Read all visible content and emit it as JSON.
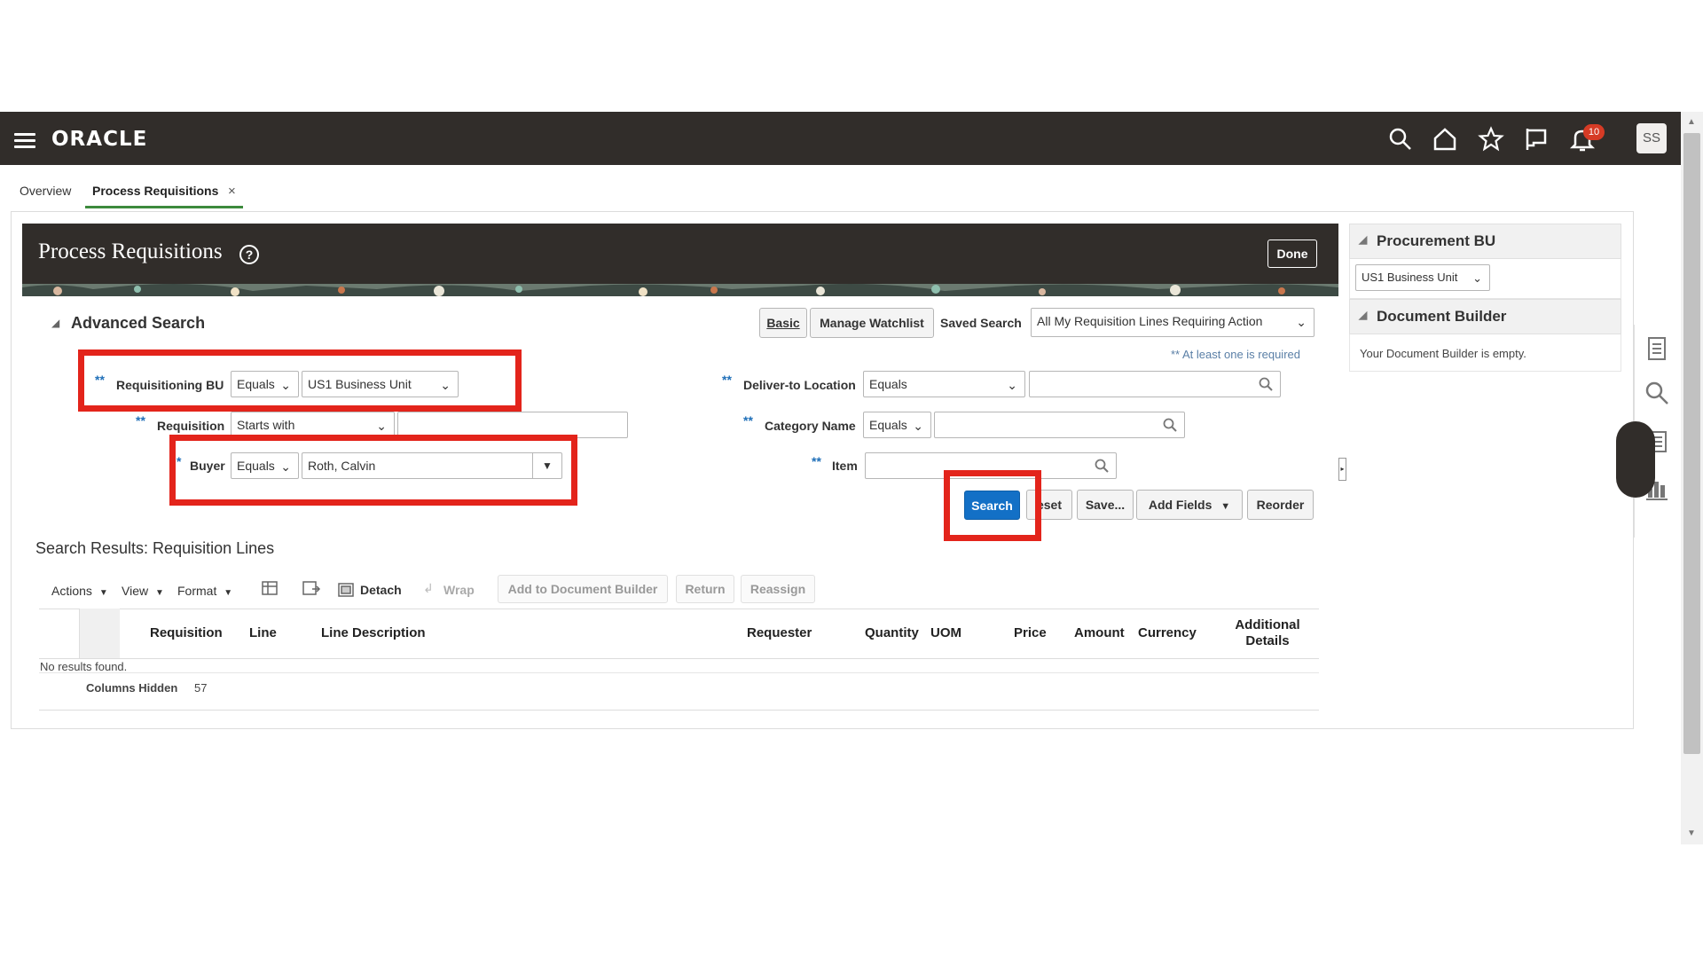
{
  "app": {
    "logo": "ORACLE",
    "notification_count": "10",
    "avatar_initials": "SS"
  },
  "tabs": {
    "overview": "Overview",
    "process_requisitions": "Process Requisitions",
    "close": "×"
  },
  "page": {
    "title": "Process Requisitions",
    "help": "?",
    "done": "Done"
  },
  "search": {
    "title": "Advanced Search",
    "basic": "Basic",
    "manage_watchlist": "Manage Watchlist",
    "saved_search_label": "Saved Search",
    "saved_search_value": "All My Requisition Lines Requiring Action",
    "required_note": "** At least one is required",
    "req_bu_label": "Requisitioning BU",
    "req_bu_op": "Equals",
    "req_bu_value": "US1 Business Unit",
    "requisition_label": "Requisition",
    "requisition_op": "Starts with",
    "buyer_label": "Buyer",
    "buyer_op": "Equals",
    "buyer_value": "Roth, Calvin",
    "deliver_label": "Deliver-to Location",
    "deliver_op": "Equals",
    "category_label": "Category Name",
    "category_op": "Equals",
    "item_label": "Item",
    "search_btn": "Search",
    "reset_btn": "eset",
    "save_btn": "Save...",
    "add_fields_btn": "Add Fields",
    "reorder_btn": "Reorder",
    "double_star": "**",
    "single_star": "*"
  },
  "results": {
    "title": "Search Results: Requisition Lines",
    "actions": "Actions",
    "view": "View",
    "format": "Format",
    "detach": "Detach",
    "wrap": "Wrap",
    "add_to_doc_builder": "Add to Document Builder",
    "return": "Return",
    "reassign": "Reassign",
    "columns": [
      "Requisition",
      "Line",
      "Line Description",
      "Requester",
      "Quantity",
      "UOM",
      "Price",
      "Amount",
      "Currency"
    ],
    "additional_1": "Additional",
    "additional_2": "Details",
    "no_results": "No results found.",
    "columns_hidden_label": "Columns Hidden",
    "columns_hidden_count": "57"
  },
  "right_panel": {
    "procurement_bu": "Procurement BU",
    "procurement_bu_value": "US1 Business Unit",
    "document_builder": "Document Builder",
    "document_builder_empty": "Your Document Builder is empty."
  },
  "colors": {
    "topbar": "#312d2a",
    "primary": "#1370c6",
    "highlight": "#e3241b",
    "required": "#1f6fb8"
  }
}
